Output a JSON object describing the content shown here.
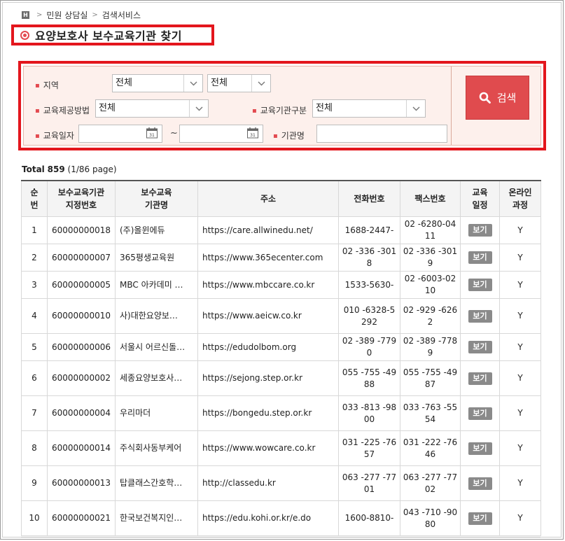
{
  "breadcrumb": {
    "home_icon": "home-icon",
    "items": [
      "민원 상담실",
      "검색서비스"
    ]
  },
  "page": {
    "title": "요양보호사 보수교육기관 찾기"
  },
  "search": {
    "region_label": "지역",
    "region_1": "전체",
    "region_2": "전체",
    "method_label": "교육제공방법",
    "method_value": "전체",
    "category_label": "교육기관구분",
    "category_value": "전체",
    "date_label": "교육일자",
    "date_from": "",
    "date_to": "",
    "date_sep": "~",
    "name_label": "기관명",
    "name_value": "",
    "search_button": "검색"
  },
  "summary": {
    "total_label": "Total",
    "total_count": "859",
    "page_info": "(1/86 page)"
  },
  "table": {
    "headers": [
      "순\n번",
      "보수교육기관\n지정번호",
      "보수교육\n기관명",
      "주소",
      "전화번호",
      "팩스번호",
      "교육\n일정",
      "온라인\n과정"
    ],
    "view_label": "보기",
    "rows": [
      {
        "no": "1",
        "code": "60000000018",
        "name": "(주)올윈에듀",
        "url": "https://care.allwinedu.net/",
        "tel": "1688-2447-",
        "fax": "02 -6280-0411",
        "online": "Y"
      },
      {
        "no": "2",
        "code": "60000000007",
        "name": "365평생교육원",
        "url": "https://www.365ecenter.com",
        "tel": "02 -336 -3018",
        "fax": "02 -336 -3019",
        "online": "Y"
      },
      {
        "no": "3",
        "code": "60000000005",
        "name": "MBC 아카데미 …",
        "url": "https://www.mbccare.co.kr",
        "tel": "1533-5630-",
        "fax": "02 -6003-0210",
        "online": "Y"
      },
      {
        "no": "4",
        "code": "60000000010",
        "name": "사)대한요양보…",
        "url": "https://www.aeicw.co.kr",
        "tel": "010 -6328-5292",
        "fax": "02 -929 -6262",
        "online": "Y"
      },
      {
        "no": "5",
        "code": "60000000006",
        "name": "서울시 어르신돌…",
        "url": "https://edudolbom.org",
        "tel": "02 -389 -7790",
        "fax": "02 -389 -7789",
        "online": "Y"
      },
      {
        "no": "6",
        "code": "60000000002",
        "name": "세종요양보호사…",
        "url": "https://sejong.step.or.kr",
        "tel": "055 -755 -4988",
        "fax": "055 -755 -4987",
        "online": "Y"
      },
      {
        "no": "7",
        "code": "60000000004",
        "name": "우리마더",
        "url": "https://bongedu.step.or.kr",
        "tel": "033 -813 -9800",
        "fax": "033 -763 -5554",
        "online": "Y"
      },
      {
        "no": "8",
        "code": "60000000014",
        "name": "주식회사동부케어",
        "url": "https://www.wowcare.co.kr",
        "tel": "031 -225 -7657",
        "fax": "031 -222 -7646",
        "online": "Y"
      },
      {
        "no": "9",
        "code": "60000000013",
        "name": "탑클래스간호학…",
        "url": "http://classedu.kr",
        "tel": "063 -277 -7701",
        "fax": "063 -277 -7702",
        "online": "Y"
      },
      {
        "no": "10",
        "code": "60000000021",
        "name": "한국보건복지인…",
        "url": "https://edu.kohi.or.kr/e.do",
        "tel": "1600-8810-",
        "fax": "043 -710 -9080",
        "online": "Y"
      }
    ]
  },
  "colors": {
    "highlight_red": "#e3161d",
    "search_button": "#e04b4e",
    "panel_bg": "#fdf0ec",
    "view_button": "#8a8a8a"
  }
}
